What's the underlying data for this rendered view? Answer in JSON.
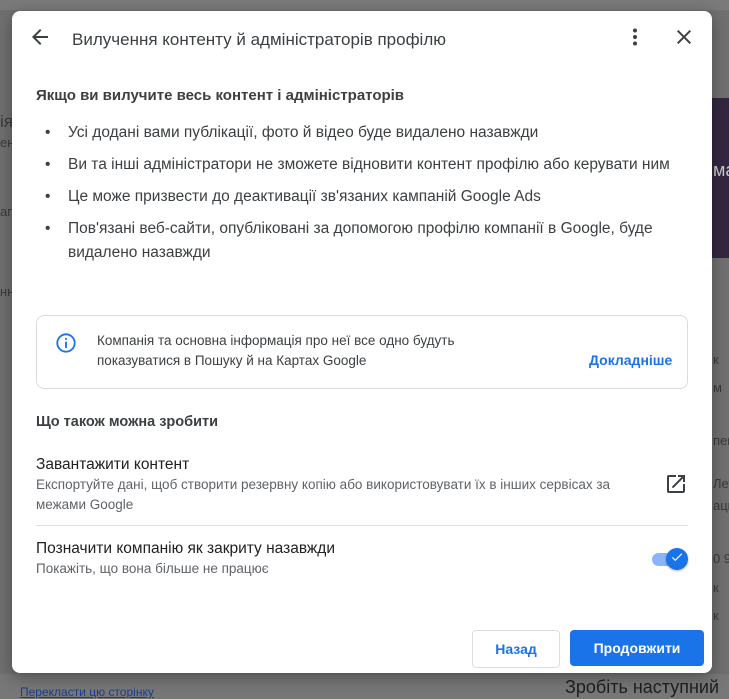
{
  "background": {
    "left_fragments": [
      "ія",
      "ен",
      "агу",
      "нн"
    ],
    "right_fragments": [
      "ма",
      "к",
      "м",
      "пем",
      "Лети",
      "ацько",
      "0 9",
      "к",
      "к"
    ],
    "bottom_link": "Перекласти цю сторінку",
    "bottom_heading": "Зробіть наступний"
  },
  "dialog": {
    "title": "Вилучення контенту й адміністраторів профілю",
    "icons": {
      "back": "arrow-back-icon",
      "more": "more-vert-icon",
      "close": "close-icon"
    },
    "warning_heading": "Якщо ви вилучите весь контент і адміністраторів",
    "bullets": [
      "Усі додані вами публікації, фото й відео буде видалено назавжди",
      "Ви та інші адміністратори не зможете відновити контент профілю або керувати ним",
      "Це може призвести до деактивації зв'язаних кампаній Google Ads",
      "Пов'язані веб-сайти, опубліковані за допомогою профілю компанії в Google, буде видалено назавжди"
    ],
    "info": {
      "text": "Компанія та основна інформація про неї все одно будуть показуватися в Пошуку й на Картах Google",
      "link": "Докладніше"
    },
    "alternatives_heading": "Що також можна зробити",
    "download": {
      "title": "Завантажити контент",
      "description": "Експортуйте дані, щоб створити резервну копію або використовувати їх в інших сервісах за межами Google"
    },
    "mark_closed": {
      "title": "Позначити компанію як закриту назавжди",
      "description": "Покажіть, що вона більше не працює",
      "checked": true
    },
    "buttons": {
      "back": "Назад",
      "continue": "Продовжити"
    }
  },
  "colors": {
    "accent": "#1a73e8",
    "toggle_track": "#8ab4f8"
  }
}
